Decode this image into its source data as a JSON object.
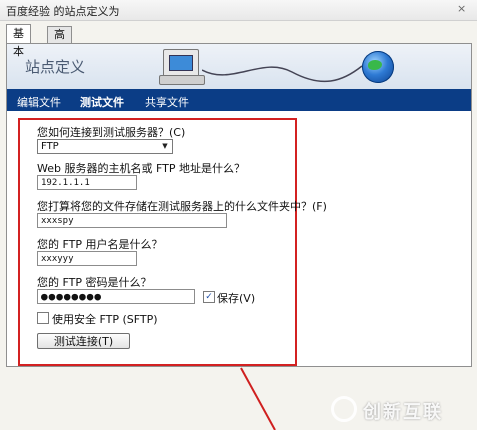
{
  "window": {
    "title": "百度经验 的站点定义为",
    "close_glyph": "×"
  },
  "tabs": [
    {
      "label": "基本",
      "active": true
    },
    {
      "label": "高级",
      "active": false
    }
  ],
  "banner": {
    "title": "站点定义"
  },
  "nav": [
    {
      "label": "编辑文件",
      "active": false
    },
    {
      "label": "测试文件",
      "active": true
    },
    {
      "label": "共享文件",
      "active": false
    }
  ],
  "form": {
    "connect_label": "您如何连接到测试服务器？(C)",
    "connect_value": "FTP",
    "host_label": "Web 服务器的主机名或 FTP 地址是什么？",
    "host_value": "192.1.1.1",
    "folder_label": "您打算将您的文件存储在测试服务器上的什么文件夹中？(F)",
    "folder_value": "xxxspy",
    "user_label": "您的 FTP 用户名是什么？",
    "user_value": "xxxyyy",
    "pwd_label": "您的 FTP 密码是什么？",
    "pwd_value": "●●●●●●●●",
    "save_label": "保存(V)",
    "save_checked": true,
    "sftp_label": "使用安全 FTP (SFTP)",
    "sftp_checked": false,
    "test_button": "测试连接(T)"
  },
  "watermark": {
    "text": "创新互联"
  },
  "colors": {
    "nav_bg": "#0b3d86",
    "highlight": "#d32121",
    "banner_bg": "#dfe7f1"
  }
}
